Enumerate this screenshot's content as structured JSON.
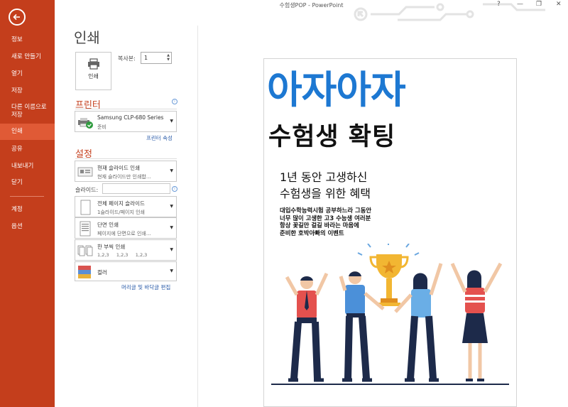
{
  "window": {
    "title": "수험생POP - PowerPoint",
    "help": "?",
    "minimize": "—",
    "restore": "❐",
    "close": "✕"
  },
  "sidebar": {
    "items": [
      {
        "label": "정보"
      },
      {
        "label": "새로 만들기"
      },
      {
        "label": "열기"
      },
      {
        "label": "저장"
      },
      {
        "label": "다른 이름으로 저장"
      },
      {
        "label": "인쇄"
      },
      {
        "label": "공유"
      },
      {
        "label": "내보내기"
      },
      {
        "label": "닫기"
      },
      {
        "label": "계정"
      },
      {
        "label": "옵션"
      }
    ],
    "active": "인쇄"
  },
  "main": {
    "title": "인쇄",
    "print_button": "인쇄",
    "copies_label": "복사본:",
    "copies_value": "1"
  },
  "printer": {
    "heading": "프린터",
    "name": "Samsung CLP-680 Series",
    "status": "준비",
    "properties_link": "프린터 속성"
  },
  "settings": {
    "heading": "설정",
    "range": {
      "title": "현재 슬라이드 인쇄",
      "desc": "현재 슬라이드만 인쇄합..."
    },
    "slides_label": "슬라이드:",
    "layout": {
      "title": "전체 페이지 슬라이드",
      "desc": "1슬라이드/페이지 인쇄"
    },
    "sides": {
      "title": "단면 인쇄",
      "desc": "페이지에 단면으로 인쇄..."
    },
    "collate": {
      "title": "한 부씩 인쇄",
      "desc": "1,2,3     1,2,3     1,2,3"
    },
    "color": {
      "title": "컬러"
    },
    "header_footer_link": "머리글 및 바닥글 편집"
  },
  "preview": {
    "headline1": "아자아자",
    "headline2": "수험생 확팅",
    "sub1": "1년 동안 고생하신",
    "sub2": "수험생을 위한 혜택",
    "body": "대입수학능력시험 공부하느라 그동안\n너무 많이 고생한 고3 수능생 여러분\n항상 꽃길만 걸길 바라는 마음에\n준비한 호박아빠의 이벤트"
  },
  "colors": {
    "accent": "#c43e1c",
    "sidebar_active": "#e05a36",
    "headline_blue": "#1d78d2",
    "link": "#2a5ba8"
  }
}
